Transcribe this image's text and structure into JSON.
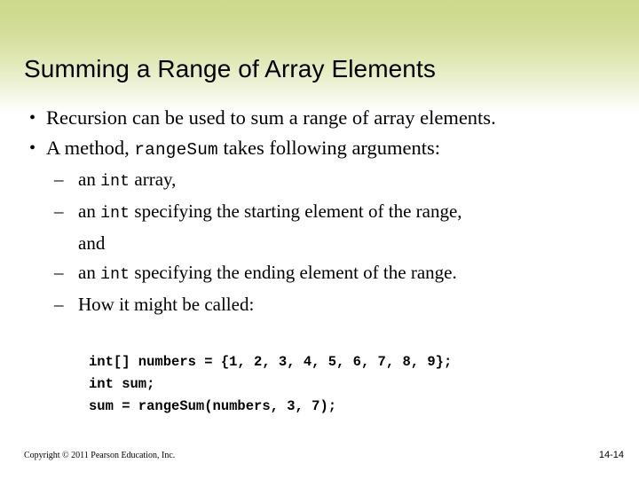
{
  "slide": {
    "title": "Summing a Range of Array Elements",
    "bullets": [
      {
        "marker": "•",
        "segments": [
          {
            "text": "Recursion can be used to sum a range of array elements.",
            "style": "normal"
          }
        ]
      },
      {
        "marker": "•",
        "segments": [
          {
            "text": "A method, ",
            "style": "normal"
          },
          {
            "text": "rangeSum",
            "style": "mono"
          },
          {
            "text": " takes following arguments:",
            "style": "normal"
          }
        ]
      }
    ],
    "sub_bullets": [
      {
        "marker": "–",
        "segments": [
          {
            "text": "an ",
            "style": "normal"
          },
          {
            "text": "int",
            "style": "mono"
          },
          {
            "text": " array,",
            "style": "normal"
          }
        ],
        "continuation": ""
      },
      {
        "marker": "–",
        "segments": [
          {
            "text": "an ",
            "style": "normal"
          },
          {
            "text": "int",
            "style": "mono"
          },
          {
            "text": " specifying the starting element of the range,",
            "style": "normal"
          }
        ],
        "continuation": "and"
      },
      {
        "marker": "–",
        "segments": [
          {
            "text": "an ",
            "style": "normal"
          },
          {
            "text": "int",
            "style": "mono"
          },
          {
            "text": " specifying the ending element of the range.",
            "style": "normal"
          }
        ],
        "continuation": ""
      },
      {
        "marker": "–",
        "segments": [
          {
            "text": "How it might be called:",
            "style": "normal"
          }
        ],
        "continuation": ""
      }
    ],
    "code_lines": [
      "int[] numbers = {1, 2, 3, 4, 5, 6, 7, 8, 9};",
      "int sum;",
      "sum = rangeSum(numbers, 3, 7);"
    ],
    "footer": {
      "copyright": "Copyright © 2011 Pearson Education, Inc.",
      "page_number": "14-14"
    },
    "colors": {
      "background_top": "#cdda8c",
      "background_bottom": "#ffffff",
      "text": "#000000"
    }
  }
}
